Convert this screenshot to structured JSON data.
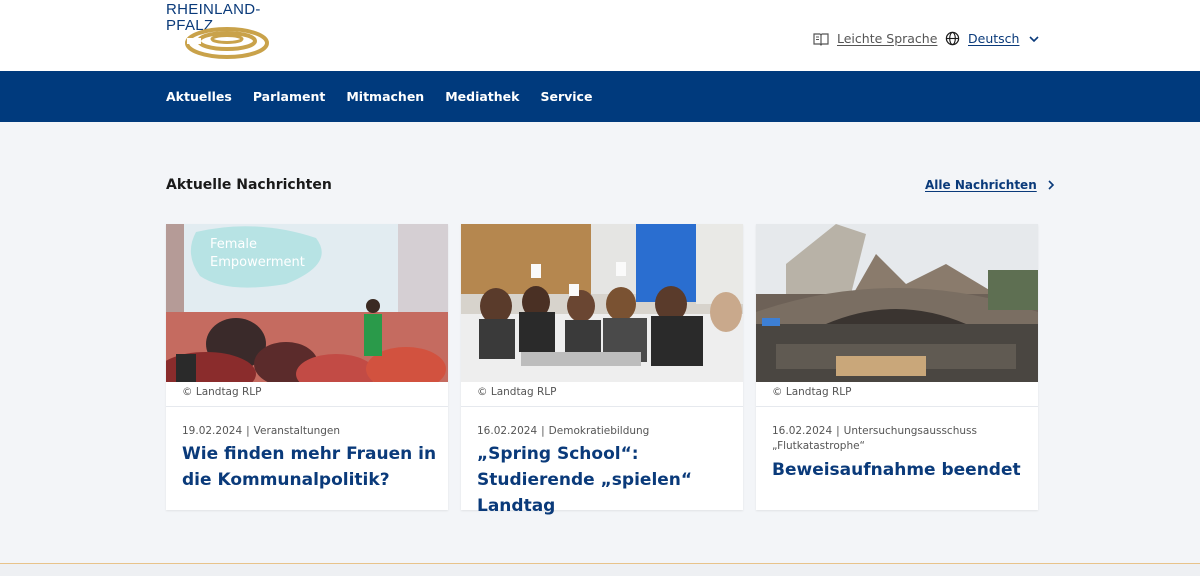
{
  "header": {
    "logo_text": "RHEINLAND-PFALZ",
    "brand_color": "#003a7d",
    "logo_color": "#c9a24a",
    "leichte_sprache_label": "Leichte Sprache",
    "leichte_sprache_icon": "book-icon",
    "language_label": "Deutsch",
    "language_icon": "globe-icon"
  },
  "nav": {
    "items": [
      {
        "label": "Aktuelles"
      },
      {
        "label": "Parlament"
      },
      {
        "label": "Mitmachen"
      },
      {
        "label": "Mediathek"
      },
      {
        "label": "Service"
      }
    ]
  },
  "news": {
    "section_title": "Aktuelle Nachrichten",
    "all_news_label": "Alle Nachrichten",
    "cards": [
      {
        "caption": "© Landtag RLP",
        "date": "19.02.2024",
        "category": "Veranstaltungen",
        "title": "Wie finden mehr Frauen in die Kommunalpolitik?",
        "image_text_1": "Female",
        "image_text_2": "Empowerment"
      },
      {
        "caption": "© Landtag RLP",
        "date": "16.02.2024",
        "category": "Demokratiebildung",
        "title": "„Spring School“: Studierende „spielen“ Landtag"
      },
      {
        "caption": "© Landtag RLP",
        "date": "16.02.2024",
        "category": "Untersuchungsausschuss „Flutkatastrophe“",
        "title": "Beweisaufnahme beendet"
      }
    ]
  }
}
